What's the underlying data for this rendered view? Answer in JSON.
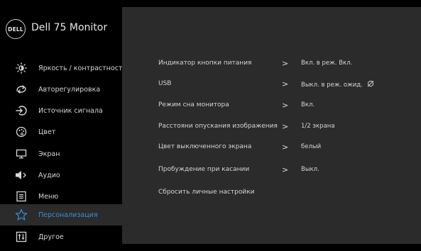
{
  "header": {
    "logo_text": "DELL",
    "model": "Dell 75 Monitor"
  },
  "sidebar": {
    "items": [
      {
        "label": "Яркость / контрастность",
        "icon": "brightness-icon"
      },
      {
        "label": "Авторегулировка",
        "icon": "auto-adjust-icon"
      },
      {
        "label": "Источник сигнала",
        "icon": "input-source-icon"
      },
      {
        "label": "Цвет",
        "icon": "palette-icon"
      },
      {
        "label": "Экран",
        "icon": "display-icon"
      },
      {
        "label": "Аудио",
        "icon": "audio-icon"
      },
      {
        "label": "Меню",
        "icon": "menu-icon"
      },
      {
        "label": "Персонализация",
        "icon": "star-icon",
        "selected": true
      },
      {
        "label": "Другое",
        "icon": "others-icon"
      }
    ]
  },
  "panel": {
    "rows": [
      {
        "name": "Индикатор кнопки питания",
        "value": "Вкл. в реж. Вкл."
      },
      {
        "name": "USB",
        "value": "Выкл. в реж. ожид."
      },
      {
        "name": "Режим сна монитора",
        "value": "Вкл."
      },
      {
        "name": "Расстояни опускания изображения",
        "value": "1/2 экрана"
      },
      {
        "name": "Цвет выключенного экрана",
        "value": "белый"
      },
      {
        "name": "Пробуждение при касании",
        "value": "Выкл."
      },
      {
        "name": "Сбросить личные настройки",
        "value": ""
      }
    ],
    "arrow_glyph": ">"
  },
  "colors": {
    "background": "#000000",
    "panel": "#2b2b2b",
    "accent": "#3a8fd6",
    "text": "#d4d4d4"
  }
}
